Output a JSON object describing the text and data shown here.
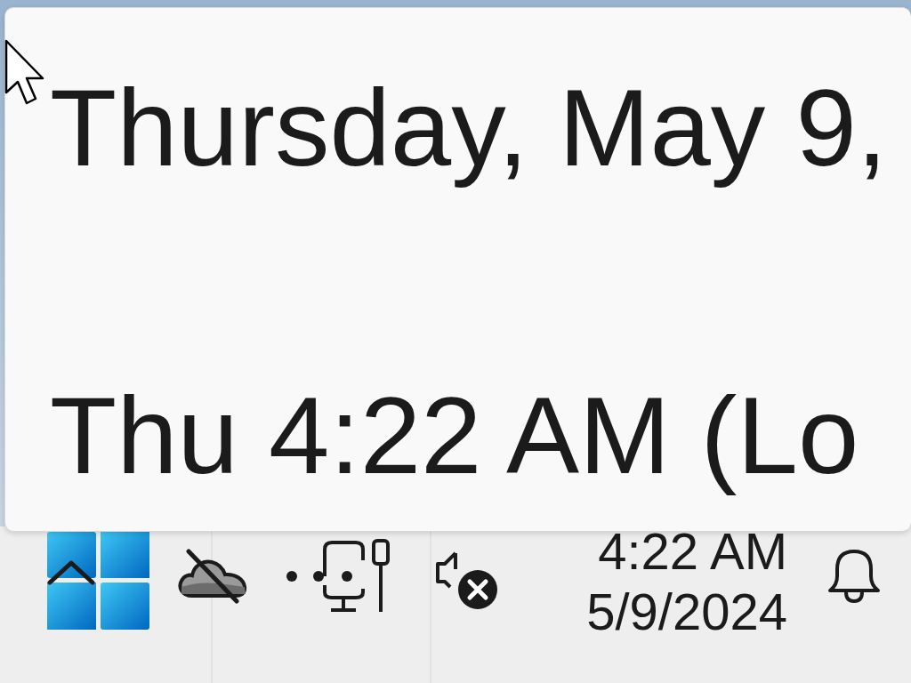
{
  "tooltip": {
    "lines": [
      "Thursday, May 9,",
      "Thu 4:22 AM (Lo"
    ]
  },
  "clock": {
    "time": "4:22 AM",
    "date": "5/9/2024"
  }
}
